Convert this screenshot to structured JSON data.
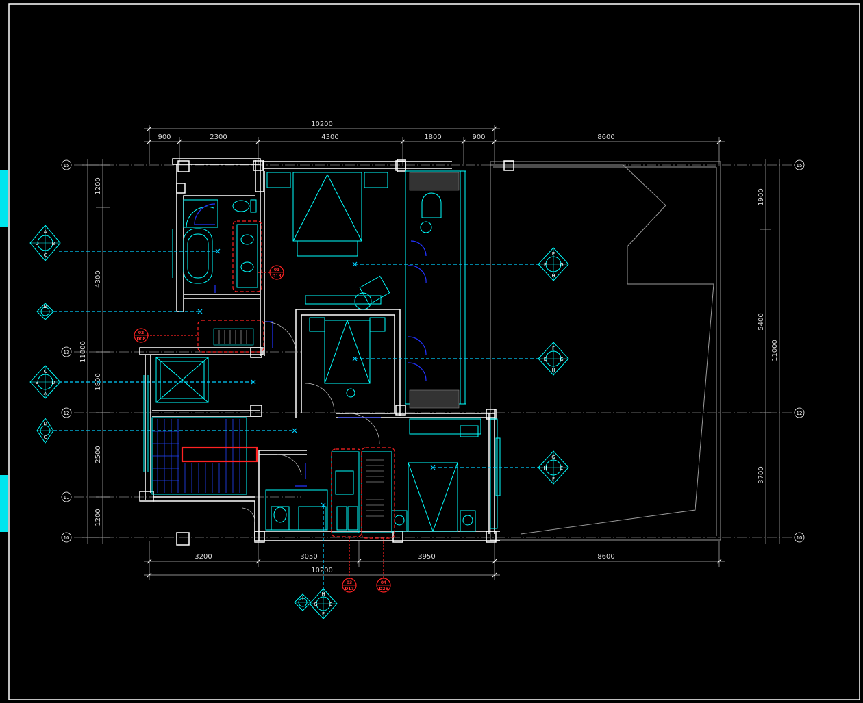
{
  "drawing": {
    "dims_top": {
      "overall": "10200",
      "segments": [
        "900",
        "2300",
        "4300",
        "1800",
        "900"
      ],
      "right": "8600"
    },
    "dims_bottom": {
      "segments": [
        "3200",
        "3050",
        "3950"
      ],
      "overall": "10200",
      "right": "8600"
    },
    "dims_left": {
      "segments": [
        "1200",
        "4300",
        "1800",
        "2500",
        "1200"
      ],
      "overall": "11000"
    },
    "dims_right": {
      "segments": [
        "1900",
        "5400",
        "3700"
      ],
      "overall": "11000"
    },
    "grid_axes": [
      "15",
      "13",
      "12",
      "11",
      "10"
    ],
    "grid_axes_right": [
      "15",
      "12",
      "10"
    ],
    "section_tags": [
      {
        "top": "01",
        "bottom": "D13"
      },
      {
        "top": "02",
        "bottom": "D08"
      },
      {
        "top": "03",
        "bottom": "D17"
      },
      {
        "top": "04",
        "bottom": "D26"
      }
    ],
    "elevation_markers": [
      {
        "id": "A",
        "refs": [
          "D",
          "B",
          "C"
        ]
      },
      {
        "id": "B",
        "refs": [
          "A",
          "C",
          "D"
        ]
      },
      {
        "id": "C",
        "refs": [
          "B",
          "D",
          "A"
        ]
      },
      {
        "id": "D",
        "refs": [
          "C",
          "A",
          "B"
        ]
      },
      {
        "id": "E",
        "refs": [
          "F",
          "G",
          "H"
        ]
      },
      {
        "id": "F",
        "refs": [
          "E",
          "G",
          "H"
        ]
      },
      {
        "id": "G",
        "refs": [
          "H",
          "E",
          "F"
        ]
      },
      {
        "id": "H",
        "refs": [
          "G",
          "E",
          "F"
        ]
      },
      {
        "id": "I",
        "refs": [
          "J",
          "K",
          "L"
        ]
      }
    ],
    "colors": {
      "background": "#000000",
      "wall": "#ffffff",
      "fixture": "#00ffff",
      "dimension": "#d8d8d8",
      "elevation_line": "#00cfff",
      "highlight": "#ff2222",
      "door": "#2233ff",
      "accent_tab": "#00e5ee"
    }
  }
}
